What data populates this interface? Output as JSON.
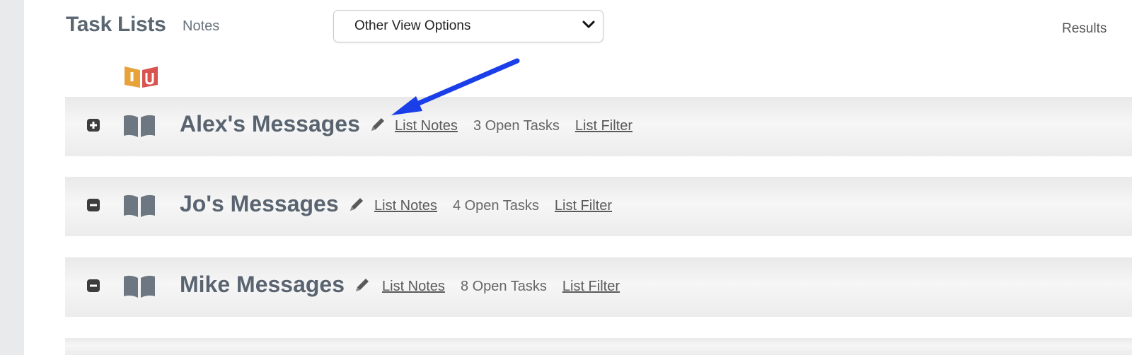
{
  "header": {
    "title": "Task Lists",
    "notes_link": "Notes",
    "view_select": "Other View Options",
    "results": "Results"
  },
  "lists": [
    {
      "name": "Alex's Messages",
      "expand_state": "collapsed",
      "notes_link": "List Notes",
      "open_tasks": "3 Open Tasks",
      "filter_link": "List Filter"
    },
    {
      "name": "Jo's Messages",
      "expand_state": "expanded",
      "notes_link": "List Notes",
      "open_tasks": "4 Open Tasks",
      "filter_link": "List Filter"
    },
    {
      "name": "Mike Messages",
      "expand_state": "expanded",
      "notes_link": "List Notes",
      "open_tasks": "8 Open Tasks",
      "filter_link": "List Filter"
    }
  ],
  "colors": {
    "title": "#5a6773",
    "row_title": "#596470",
    "logo_orange": "#e8a23a",
    "logo_red": "#d9534f",
    "annotation_arrow": "#1a3ee8"
  },
  "icons": {
    "expand": "plus-square-icon",
    "collapse": "minus-square-icon",
    "book": "open-book-icon",
    "edit": "pencil-icon",
    "dropdown": "chevron-down-icon"
  }
}
